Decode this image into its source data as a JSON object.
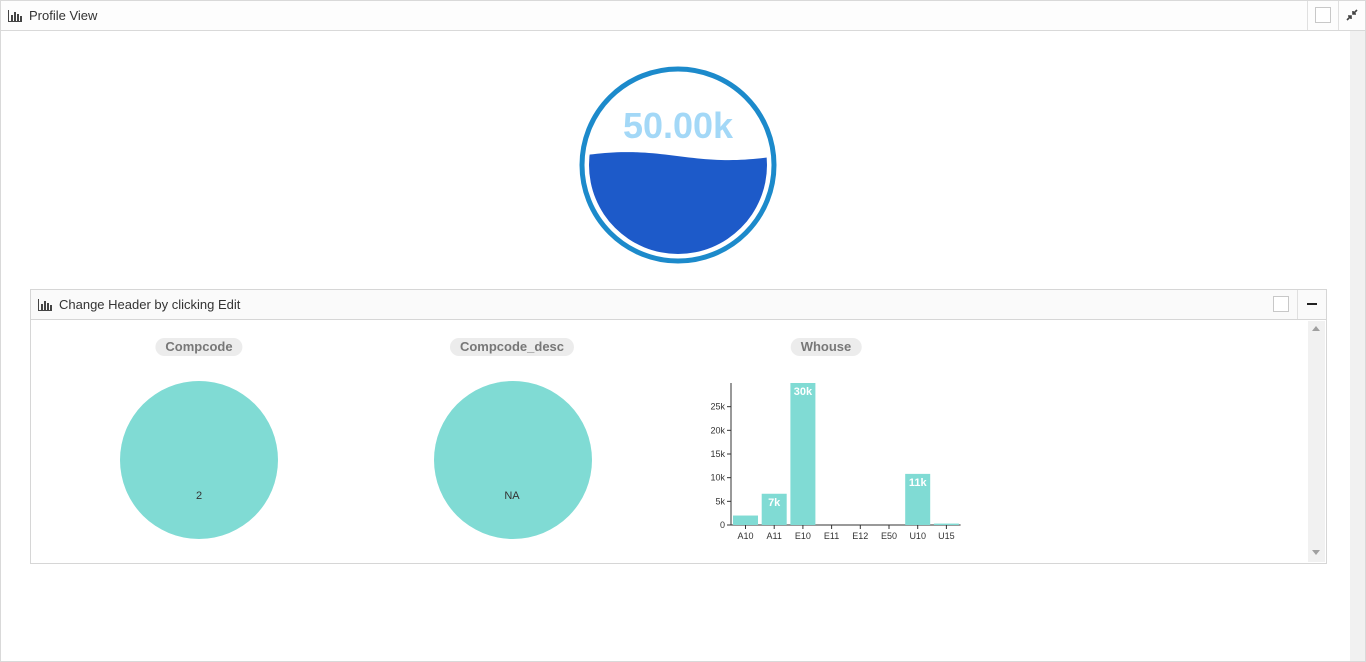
{
  "outer_panel": {
    "title": "Profile View"
  },
  "gauge": {
    "value_label": "50.00k",
    "fill_fraction": 0.55,
    "ring_color": "#1c8acb",
    "fill_color": "#1d5ac9",
    "text_color": "#a3d8f7"
  },
  "inner_panel": {
    "title": "Change Header by clicking Edit"
  },
  "charts": {
    "compcode": {
      "title": "Compcode",
      "slice_label": "2",
      "color": "#80dbd4"
    },
    "compcode_desc": {
      "title": "Compcode_desc",
      "slice_label": "NA",
      "color": "#80dbd4"
    },
    "whouse": {
      "title": "Whouse"
    }
  },
  "chart_data": [
    {
      "type": "pie",
      "title": "Compcode",
      "slices": [
        {
          "label": "2",
          "value": 1
        }
      ]
    },
    {
      "type": "pie",
      "title": "Compcode_desc",
      "slices": [
        {
          "label": "NA",
          "value": 1
        }
      ]
    },
    {
      "type": "bar",
      "title": "Whouse",
      "categories": [
        "A10",
        "A11",
        "E10",
        "E11",
        "E12",
        "E50",
        "U10",
        "U15"
      ],
      "values": [
        2000,
        6600,
        30000,
        0,
        0,
        0,
        10800,
        300
      ],
      "data_labels": [
        "",
        "7k",
        "30k",
        "",
        "",
        "",
        "11k",
        ""
      ],
      "ylim": [
        0,
        30000
      ],
      "yticks": [
        0,
        5000,
        10000,
        15000,
        20000,
        25000
      ],
      "ytick_labels": [
        "0",
        "5k",
        "10k",
        "15k",
        "20k",
        "25k"
      ],
      "color": "#80dbd4"
    }
  ]
}
